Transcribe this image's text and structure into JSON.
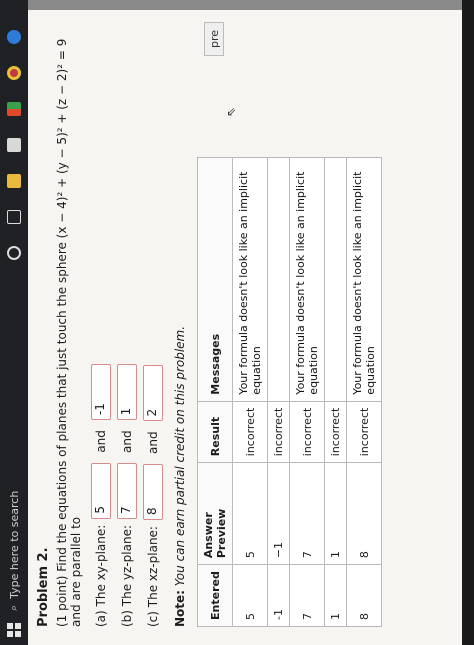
{
  "taskbar": {
    "search_placeholder": "Type here to search"
  },
  "problem": {
    "title": "Problem 2.",
    "prompt": "(1 point) Find the equations of planes that just touch the sphere (x − 4)² + (y − 5)² + (z − 2)² = 9 and are parallel to",
    "parts": [
      {
        "label": "(a) The xy-plane:",
        "v1": "5",
        "and": "and",
        "v2": "-1"
      },
      {
        "label": "(b) The yz-plane:",
        "v1": "7",
        "and": "and",
        "v2": "1"
      },
      {
        "label": "(c) The xz-plane:",
        "v1": "8",
        "and": "and",
        "v2": "2"
      }
    ],
    "note_label": "Note:",
    "note_text": "You can earn partial credit on this problem."
  },
  "results": {
    "headers": [
      "Entered",
      "Answer Preview",
      "Result",
      "Messages"
    ],
    "rows": [
      [
        "5",
        "5",
        "incorrect",
        "Your formula doesn't look like an implicit equation"
      ],
      [
        "-1",
        "−1",
        "incorrect",
        ""
      ],
      [
        "7",
        "7",
        "incorrect",
        "Your formula doesn't look like an implicit equation"
      ],
      [
        "1",
        "1",
        "incorrect",
        ""
      ],
      [
        "8",
        "8",
        "incorrect",
        "Your formula doesn't look like an implicit equation"
      ]
    ]
  },
  "side_button": {
    "label": "pre"
  },
  "colors": {
    "field_border": "#d98a8a",
    "paper": "#f6f5f2",
    "taskbar": "#1f2124"
  }
}
